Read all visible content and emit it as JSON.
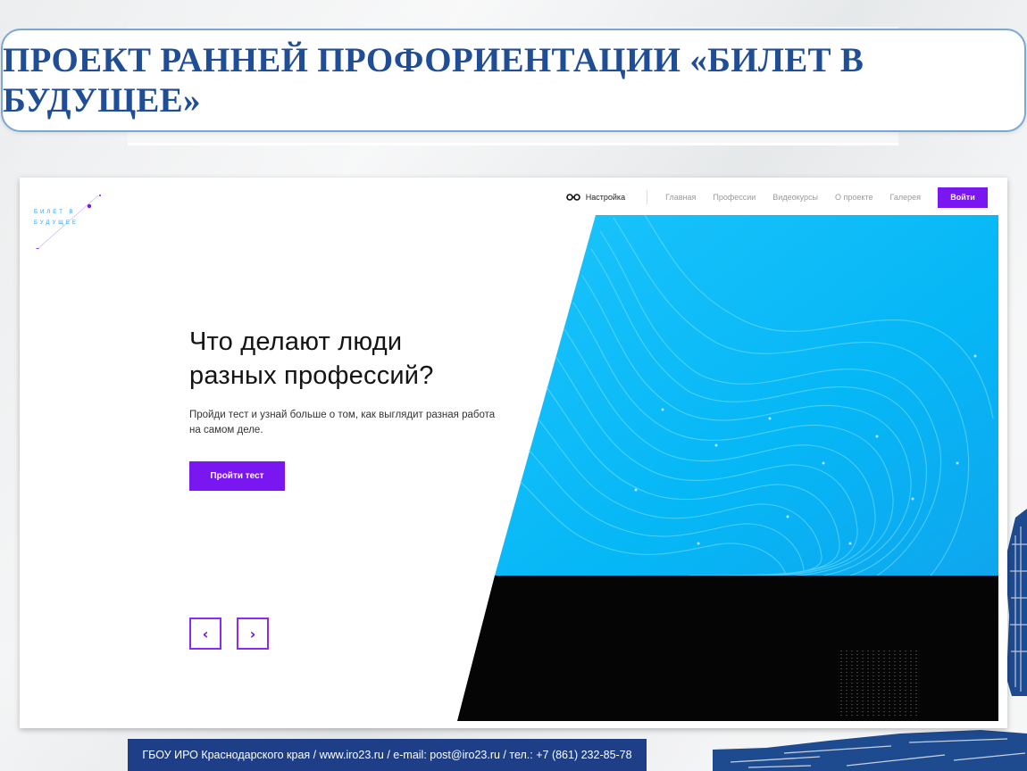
{
  "slide": {
    "title": "ПРОЕКТ РАННЕЙ ПРОФОРИЕНТАЦИИ «БИЛЕТ В БУДУЩЕЕ»",
    "footer": "ГБОУ ИРО Краснодарского края / www.iro23.ru / e-mail: post@iro23.ru / тел.: +7 (861) 232-85-78"
  },
  "site": {
    "logo": {
      "line1": "БИЛЕТ В",
      "line2": "БУДУЩЕЕ"
    },
    "nav": {
      "settings_icon": "glasses-icon",
      "settings_label": "Настройка",
      "links": [
        "Главная",
        "Профессии",
        "Видеокурсы",
        "О проекте",
        "Галерея"
      ],
      "login_label": "Войти"
    },
    "hero": {
      "heading_line1": "Что делают люди",
      "heading_line2": "разных профессий?",
      "subtext": "Пройди тест и узнай больше о том, как выглядит разная работа на самом деле.",
      "cta_label": "Пройти тест",
      "prev_icon": "chevron-left-icon",
      "next_icon": "chevron-right-icon"
    },
    "colors": {
      "accent": "#7a16f0",
      "art_blue": "#05b8f8",
      "art_dark": "#050505",
      "title_text": "#1f4e96",
      "footer_bg": "#1e3f87"
    }
  }
}
